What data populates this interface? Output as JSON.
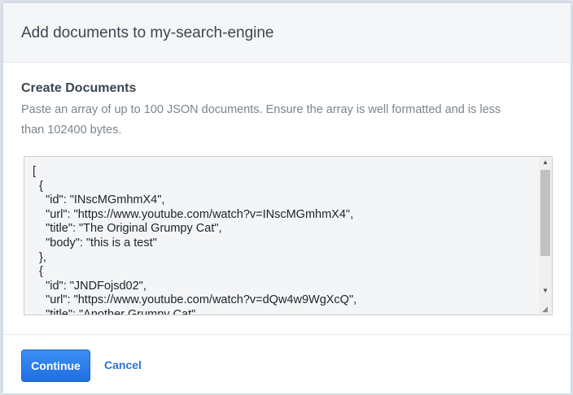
{
  "dialog": {
    "title": "Add documents to my-search-engine"
  },
  "section": {
    "heading": "Create Documents",
    "description": "Paste an array of up to 100 JSON documents. Ensure the array is well formatted and is less than 102400 bytes."
  },
  "editor": {
    "value": "[\n  {\n    \"id\": \"INscMGmhmX4\",\n    \"url\": \"https://www.youtube.com/watch?v=INscMGmhmX4\",\n    \"title\": \"The Original Grumpy Cat\",\n    \"body\": \"this is a test\"\n  },\n  {\n    \"id\": \"JNDFojsd02\",\n    \"url\": \"https://www.youtube.com/watch?v=dQw4w9WgXcQ\",\n    \"title\": \"Another Grumpy Cat\""
  },
  "footer": {
    "continue_label": "Continue",
    "cancel_label": "Cancel"
  },
  "colors": {
    "primary": "#1f6fe0",
    "link": "#2a73d8",
    "header_bg": "#f4f6f8"
  },
  "icons": {
    "scroll_up": "triangle-up-icon",
    "scroll_down": "triangle-down-icon",
    "resize": "resize-grip-icon"
  }
}
